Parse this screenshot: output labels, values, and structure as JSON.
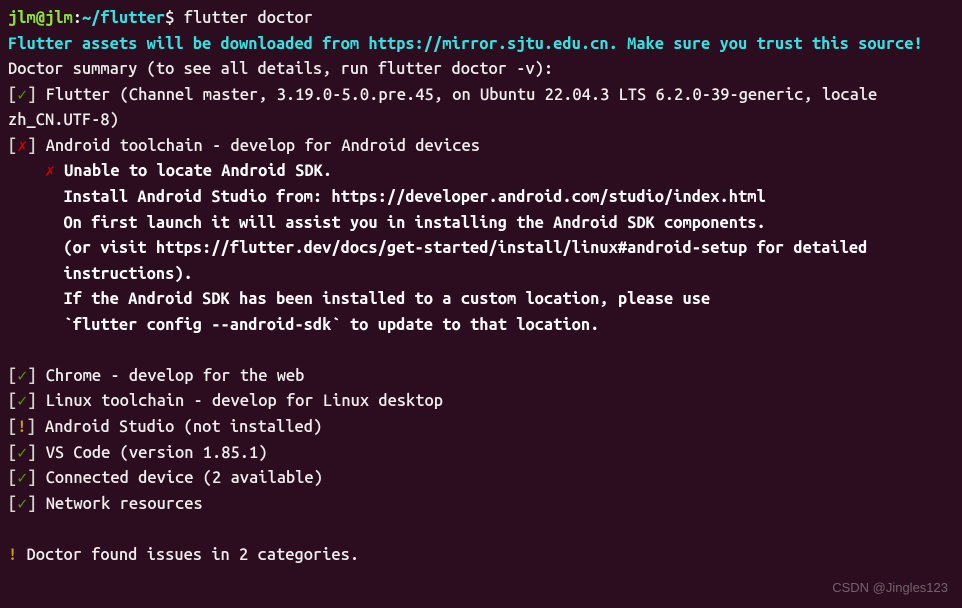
{
  "prompt": {
    "user": "jlm@jlm",
    "separator": ":",
    "path": "~/flutter",
    "dollar": "$",
    "command": "flutter doctor"
  },
  "download_msg": "Flutter assets will be downloaded from https://mirror.sjtu.edu.cn. Make sure you trust this source!",
  "summary_header": "Doctor summary (to see all details, run flutter doctor -v):",
  "checks": {
    "flutter": {
      "bracket_open": "[",
      "mark": "✓",
      "bracket_close": "]",
      "text": "Flutter (Channel master, 3.19.0-5.0.pre.45, on Ubuntu 22.04.3 LTS 6.2.0-39-generic, locale zh_CN.UTF-8)"
    },
    "android_toolchain": {
      "bracket_open": "[",
      "mark": "✗",
      "bracket_close": "]",
      "text": "Android toolchain - develop for Android devices",
      "sub_mark": "✗",
      "sub1": "Unable to locate Android SDK.",
      "sub2": "Install Android Studio from: https://developer.android.com/studio/index.html",
      "sub3": "On first launch it will assist you in installing the Android SDK components.",
      "sub4": "(or visit https://flutter.dev/docs/get-started/install/linux#android-setup for detailed instructions).",
      "sub5": "If the Android SDK has been installed to a custom location, please use",
      "sub6": "`flutter config --android-sdk` to update to that location."
    },
    "chrome": {
      "bracket_open": "[",
      "mark": "✓",
      "bracket_close": "]",
      "text": "Chrome - develop for the web"
    },
    "linux_toolchain": {
      "bracket_open": "[",
      "mark": "✓",
      "bracket_close": "]",
      "text": "Linux toolchain - develop for Linux desktop"
    },
    "android_studio": {
      "bracket_open": "[",
      "mark": "!",
      "bracket_close": "]",
      "text": "Android Studio (not installed)"
    },
    "vscode": {
      "bracket_open": "[",
      "mark": "✓",
      "bracket_close": "]",
      "text": "VS Code (version 1.85.1)"
    },
    "connected": {
      "bracket_open": "[",
      "mark": "✓",
      "bracket_close": "]",
      "text": "Connected device (2 available)"
    },
    "network": {
      "bracket_open": "[",
      "mark": "✓",
      "bracket_close": "]",
      "text": "Network resources"
    }
  },
  "footer_mark": "!",
  "footer_text": " Doctor found issues in 2 categories.",
  "watermark": "CSDN @Jingles123"
}
